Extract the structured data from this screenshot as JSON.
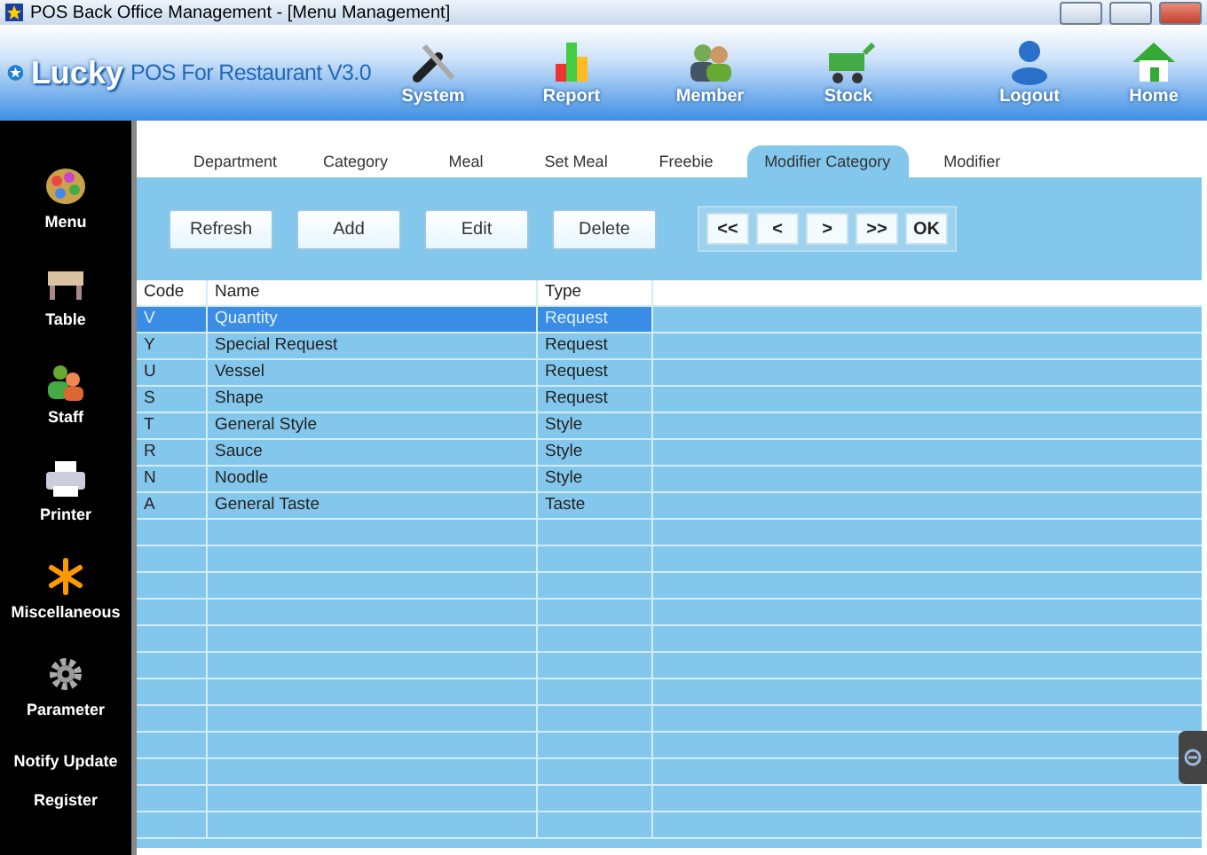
{
  "window": {
    "title": "POS Back Office Management - [Menu Management]"
  },
  "brand": {
    "name": "Lucky",
    "subtitle": "POS For Restaurant V3.0"
  },
  "toolbar": [
    {
      "label": "System",
      "kind": "tools"
    },
    {
      "label": "Report",
      "kind": "chart"
    },
    {
      "label": "Member",
      "kind": "people"
    },
    {
      "label": "Stock",
      "kind": "cart"
    },
    {
      "label": "Logout",
      "kind": "user"
    },
    {
      "label": "Home",
      "kind": "house"
    }
  ],
  "sidebar": {
    "items": [
      {
        "label": "Menu",
        "kind": "palette"
      },
      {
        "label": "Table",
        "kind": "table"
      },
      {
        "label": "Staff",
        "kind": "staff"
      },
      {
        "label": "Printer",
        "kind": "printer"
      },
      {
        "label": "Miscellaneous",
        "kind": "star"
      },
      {
        "label": "Parameter",
        "kind": "gear"
      },
      {
        "label": "Notify Update",
        "kind": "text"
      },
      {
        "label": "Register",
        "kind": "text"
      }
    ]
  },
  "tabs": [
    {
      "label": "Department",
      "selected": false
    },
    {
      "label": "Category",
      "selected": false
    },
    {
      "label": "Meal",
      "selected": false
    },
    {
      "label": "Set Meal",
      "selected": false
    },
    {
      "label": "Freebie",
      "selected": false
    },
    {
      "label": "Modifier Category",
      "selected": true
    },
    {
      "label": "Modifier",
      "selected": false
    }
  ],
  "actions": [
    "Refresh",
    "Add",
    "Edit",
    "Delete"
  ],
  "pager": [
    "<<",
    "<",
    ">",
    ">>",
    "OK"
  ],
  "table": {
    "columns": [
      "Code",
      "Name",
      "Type"
    ],
    "rows": [
      {
        "cells": [
          "V",
          "Quantity",
          "Request"
        ],
        "selected": true
      },
      {
        "cells": [
          "Y",
          "Special Request",
          "Request"
        ],
        "selected": false
      },
      {
        "cells": [
          "U",
          "Vessel",
          "Request"
        ],
        "selected": false
      },
      {
        "cells": [
          "S",
          "Shape",
          "Request"
        ],
        "selected": false
      },
      {
        "cells": [
          "T",
          "General Style",
          "Style"
        ],
        "selected": false
      },
      {
        "cells": [
          "R",
          "Sauce",
          "Style"
        ],
        "selected": false
      },
      {
        "cells": [
          "N",
          "Noodle",
          "Style"
        ],
        "selected": false
      },
      {
        "cells": [
          "A",
          "General Taste",
          "Taste"
        ],
        "selected": false
      }
    ]
  }
}
